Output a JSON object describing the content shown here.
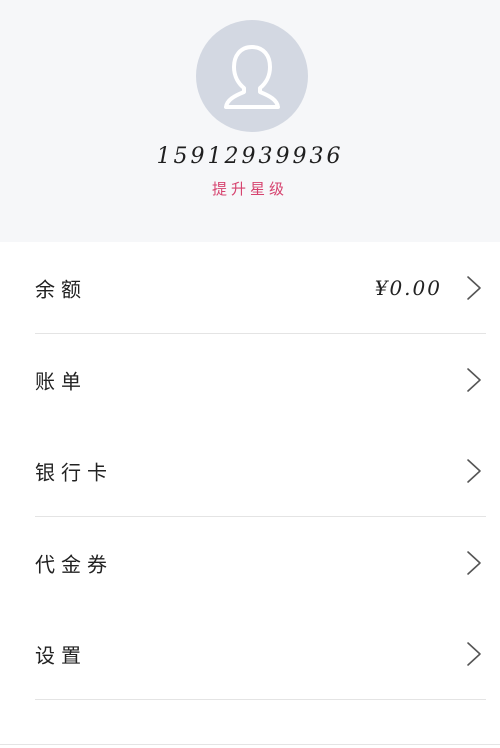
{
  "profile": {
    "avatar_icon": "user-silhouette-icon",
    "phone": "15912939936",
    "upgrade_label": "提升星级"
  },
  "menu": {
    "chevron_icon": "chevron-right-icon",
    "items": [
      {
        "label": "余额",
        "value": "¥0.00"
      },
      {
        "label": "账单",
        "value": ""
      },
      {
        "label": "银行卡",
        "value": ""
      },
      {
        "label": "代金券",
        "value": ""
      },
      {
        "label": "设置",
        "value": ""
      }
    ]
  },
  "colors": {
    "accent": "#d6436f",
    "header_bg": "#f6f7f9",
    "avatar_bg": "#d3d8e2"
  }
}
